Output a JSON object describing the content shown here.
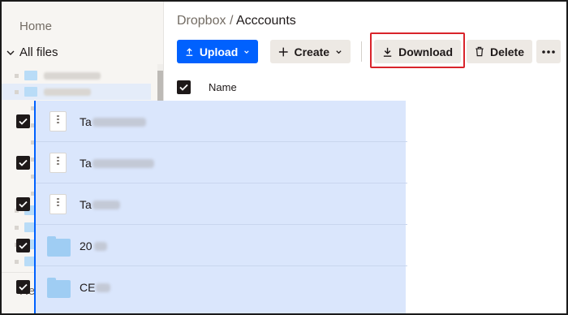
{
  "sidebar": {
    "home": "Home",
    "all_files": "All files",
    "recents": "Recents"
  },
  "breadcrumb": {
    "root": "Dropbox",
    "separator": "/",
    "current": "Acccounts"
  },
  "toolbar": {
    "upload": "Upload",
    "create": "Create",
    "download": "Download",
    "delete": "Delete"
  },
  "table": {
    "name_header": "Name"
  },
  "files": [
    {
      "prefix": "Ta",
      "type": "zip",
      "selected": true
    },
    {
      "prefix": "Ta",
      "type": "zip",
      "selected": true
    },
    {
      "prefix": "Ta",
      "type": "zip",
      "selected": true
    },
    {
      "prefix": "20",
      "type": "folder",
      "selected": true
    },
    {
      "prefix": "CE",
      "type": "folder",
      "selected": true
    }
  ],
  "colors": {
    "accent": "#0061fe",
    "selection": "#dae6fc",
    "highlight_box": "#d9242b",
    "sidebar_bg": "#f7f5f2"
  }
}
